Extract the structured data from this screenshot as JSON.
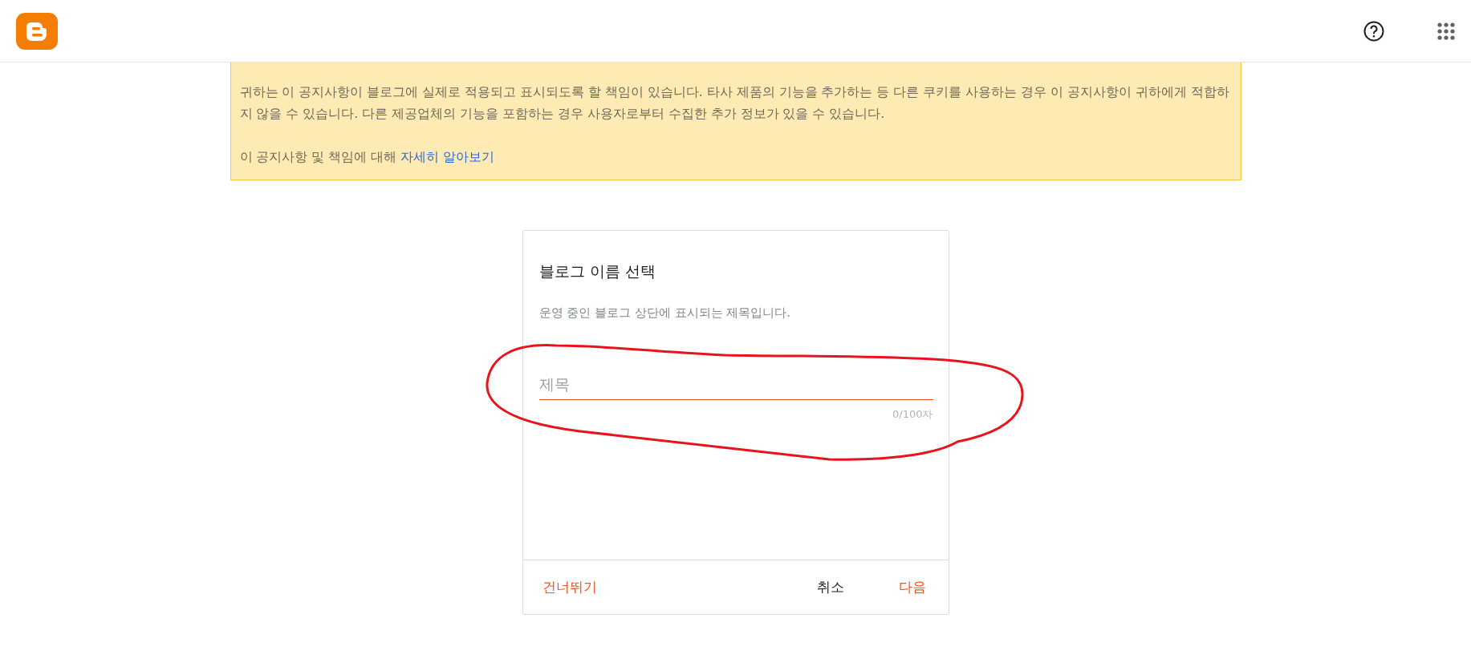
{
  "header": {
    "logo": {
      "kind": "blogger"
    },
    "actions": [
      {
        "kind": "help"
      },
      {
        "kind": "apps"
      }
    ]
  },
  "notice": {
    "paragraphs": [
      "귀하는 이 공지사항이 블로그에 실제로 적용되고 표시되도록 할 책임이 있습니다. 타사 제품의 기능을 추가하는 등 다른 쿠키를 사용하는 경우 이 공지사항이 귀하에게 적합하지 않을 수 있습니다. 다른 제공업체의 기능을 포함하는 경우 사용자로부터 수집한 추가 정보가 있을 수 있습니다."
    ],
    "learn_more": {
      "text": "이 공지사항 및 책임에 대해 ",
      "link": "자세히 알아보기"
    }
  },
  "dialog": {
    "title": "블로그 이름 선택",
    "subtitle": "운영 중인 블로그 상단에 표시되는 제목입니다.",
    "field": {
      "placeholder": "제목",
      "counter": "0/100자"
    },
    "buttons": [
      {
        "label": "건너뛰기",
        "kind": "accent"
      },
      {
        "label": "취소",
        "kind": "plain"
      },
      {
        "label": "다음",
        "kind": "accent"
      }
    ]
  },
  "annotation": {
    "kind": "freehand-ellipse"
  }
}
